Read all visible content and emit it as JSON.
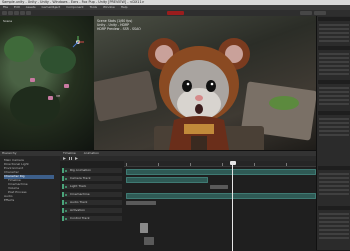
{
  "window": {
    "title": "Sample.unity - Unity - Unity - Windows - Ears - Fox Pup - Unity [PREVIEW] - <DX11>"
  },
  "menu": [
    "File",
    "Edit",
    "Assets",
    "GameObject",
    "Component",
    "Tools",
    "Window",
    "Help"
  ],
  "viewport_overlay": {
    "line1": "Scene Stats (1/60 fps)",
    "line2": "Unity - Unity - HDRP",
    "line3": "HDRP Preview - SSR - SSAO"
  },
  "left_view_labels": [
    "Scene",
    "VH"
  ],
  "timeline": {
    "tabs": [
      "Timeline",
      "Animation"
    ],
    "ruler_ticks": [
      "0",
      "30",
      "60",
      "90",
      "120",
      "150"
    ],
    "tracks": [
      "Rig Animation",
      "Camera Track",
      "Light Track",
      "Cinemachine",
      "Audio Track",
      "Activation",
      "Control Track"
    ]
  },
  "hierarchy": {
    "tab": "Hierarchy",
    "items": [
      "Main Camera",
      "Directional Light",
      "Environment",
      "Character",
      "Character Rig",
      "Timeline",
      "Cinemachine",
      "Volume",
      "Post Process",
      "Audio",
      "Effects"
    ]
  },
  "colors": {
    "accent_green": "#4aa37a",
    "selection": "#3d5f8a",
    "record": "#9a1d1d"
  }
}
